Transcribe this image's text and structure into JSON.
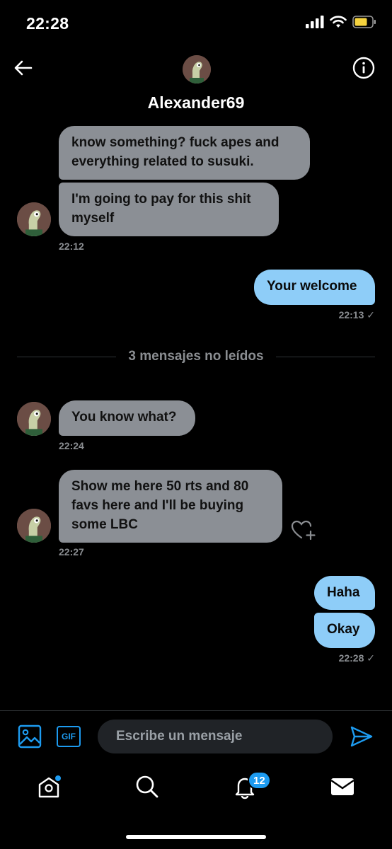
{
  "status_bar": {
    "time": "22:28",
    "icons": [
      "signal-icon",
      "wifi-icon",
      "battery-icon"
    ]
  },
  "header": {
    "back_icon": "arrow-left-icon",
    "contact_name": "Alexander69",
    "info_icon": "info-icon"
  },
  "messages": [
    {
      "direction": "received",
      "text": "know something? fuck apes and everything related to susuki."
    },
    {
      "direction": "received",
      "text": "I'm going to pay for this shit myself",
      "time": "22:12"
    },
    {
      "direction": "sent",
      "text": "Your welcome",
      "time": "22:13 ✓"
    },
    {
      "direction": "received",
      "text": "You know what?",
      "time": "22:24"
    },
    {
      "direction": "received",
      "text": "Show me here 50 rts and 80 favs here and I'll be buying some LBC",
      "time": "22:27"
    },
    {
      "direction": "sent",
      "text": "Haha"
    },
    {
      "direction": "sent",
      "text": "Okay",
      "time": "22:28 ✓"
    }
  ],
  "unread_divider": "3 mensajes no leídos",
  "composer": {
    "placeholder": "Escribe un mensaje",
    "image_icon": "image-icon",
    "gif_label": "GIF",
    "send_icon": "send-icon"
  },
  "tab_bar": {
    "home_icon": "home-icon",
    "search_icon": "search-icon",
    "notifications_icon": "bell-icon",
    "notifications_badge": "12",
    "messages_icon": "mail-icon"
  },
  "colors": {
    "background": "#000000",
    "received_bubble": "#8b8f95",
    "sent_bubble": "#8ecdf8",
    "accent": "#1d9bf0",
    "timestamp": "#8a8d91"
  }
}
